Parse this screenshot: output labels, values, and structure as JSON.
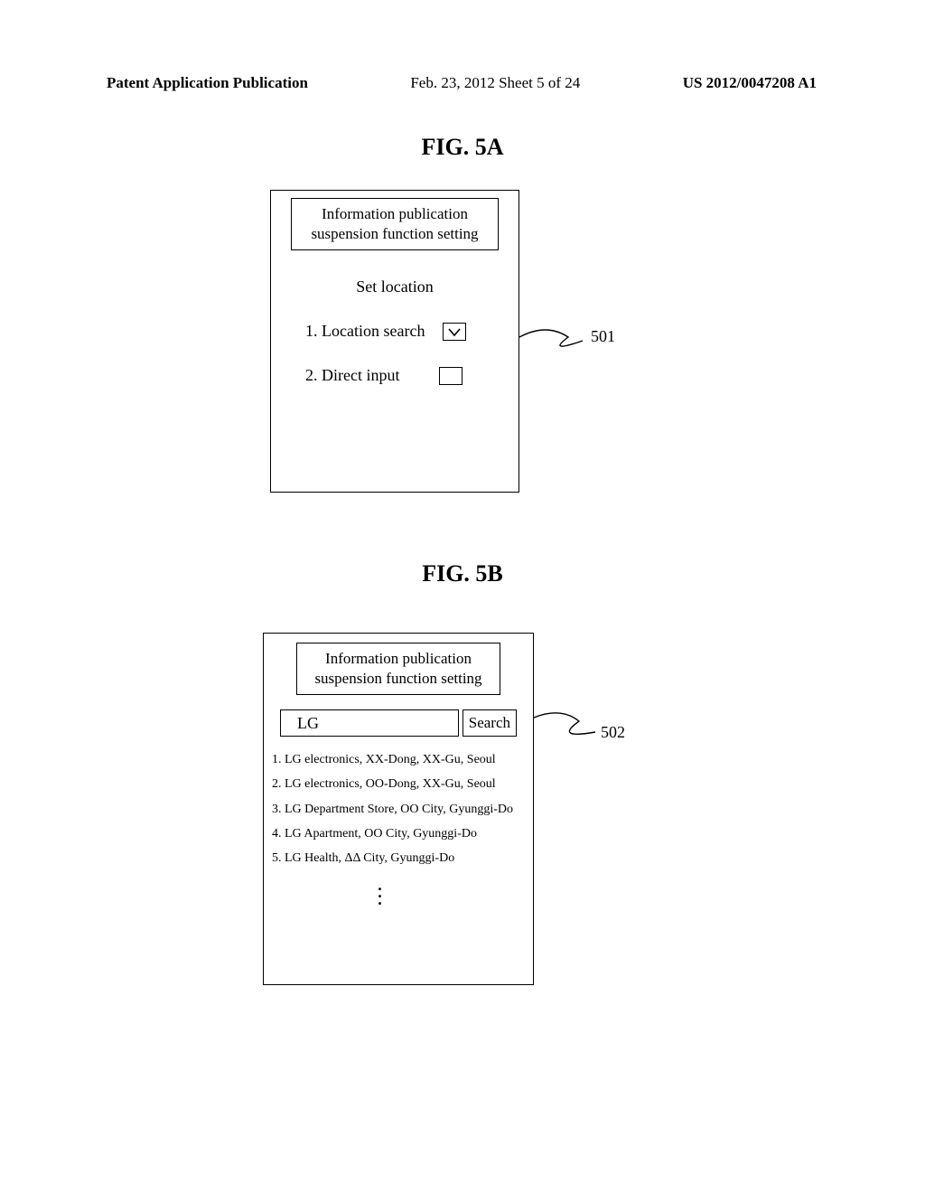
{
  "header": {
    "left": "Patent Application Publication",
    "middle": "Feb. 23, 2012  Sheet 5 of 24",
    "right": "US 2012/0047208 A1"
  },
  "figA": {
    "label": "FIG. 5A",
    "title_line1": "Information publication",
    "title_line2": "suspension function setting",
    "set_location": "Set location",
    "row1": "1. Location search",
    "row2": "2. Direct input",
    "ref": "501"
  },
  "figB": {
    "label": "FIG. 5B",
    "title_line1": "Information publication",
    "title_line2": "suspension function setting",
    "search_value": "LG",
    "search_button": "Search",
    "results": [
      "1. LG electronics, XX-Dong, XX-Gu, Seoul",
      "2. LG electronics, OO-Dong, XX-Gu, Seoul",
      "3. LG Department Store, OO City, Gyunggi-Do",
      "4. LG Apartment, OO City, Gyunggi-Do",
      "5. LG Health, ΔΔ City, Gyunggi-Do"
    ],
    "ref": "502"
  }
}
